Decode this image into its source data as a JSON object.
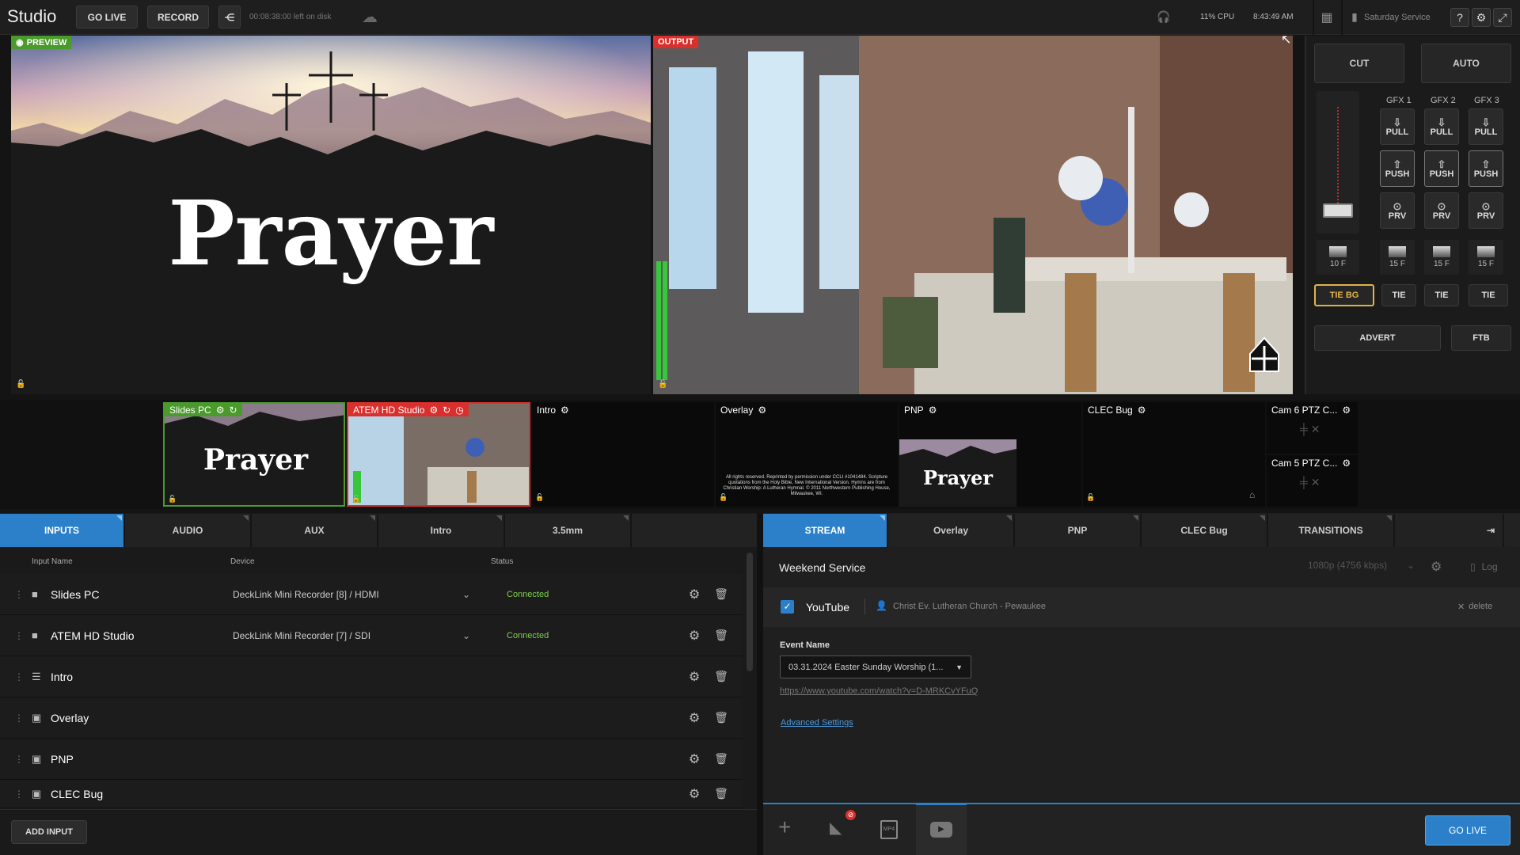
{
  "app": {
    "title": "Studio"
  },
  "topbar": {
    "go_live": "GO LIVE",
    "record": "RECORD",
    "disk_left": "00:08:38:00 left on disk",
    "cpu": "11% CPU",
    "clock": "8:43:49 AM",
    "service": "Saturday Service"
  },
  "preview": {
    "label": "PREVIEW",
    "slide_text": "Prayer"
  },
  "output": {
    "label": "OUTPUT"
  },
  "controls": {
    "cut": "CUT",
    "auto": "AUTO",
    "gfx": [
      {
        "name": "GFX 1",
        "pull": "PULL",
        "push": "PUSH",
        "prv": "PRV",
        "rate": "15 F"
      },
      {
        "name": "GFX 2",
        "pull": "PULL",
        "push": "PUSH",
        "prv": "PRV",
        "rate": "15 F"
      },
      {
        "name": "GFX 3",
        "pull": "PULL",
        "push": "PUSH",
        "prv": "PRV",
        "rate": "15 F"
      }
    ],
    "main_rate": "10 F",
    "tie_bg": "TIE BG",
    "tie": "TIE",
    "advert": "ADVERT",
    "ftb": "FTB"
  },
  "multiview": [
    {
      "label": "Slides PC",
      "state": "preview",
      "text": "Prayer"
    },
    {
      "label": "ATEM HD Studio",
      "state": "program"
    },
    {
      "label": "Intro"
    },
    {
      "label": "Overlay",
      "fine_print": "All rights reserved. Reprinted by permission under CCLI #1041484. Scripture quotations from the Holy Bible, New International Version. Hymns are from Christian Worship: A Lutheran Hymnal. © 2011 Northwestern Publishing House, Milwaukee, WI."
    },
    {
      "label": "PNP",
      "text": "Prayer"
    },
    {
      "label": "CLEC Bug"
    },
    {
      "label": "Cam 6 PTZ C..."
    },
    {
      "label": "Cam 5 PTZ C..."
    }
  ],
  "inputs_panel": {
    "tabs": [
      "INPUTS",
      "AUDIO",
      "AUX",
      "Intro",
      "3.5mm"
    ],
    "columns": [
      "Input Name",
      "Device",
      "Status"
    ],
    "rows": [
      {
        "name": "Slides PC",
        "device": "DeckLink Mini Recorder [8] / HDMI",
        "status": "Connected",
        "icon": "camera-icon"
      },
      {
        "name": "ATEM HD Studio",
        "device": "DeckLink Mini Recorder [7] / SDI",
        "status": "Connected",
        "icon": "camera-icon"
      },
      {
        "name": "Intro",
        "device": "",
        "status": "",
        "icon": "playlist-icon"
      },
      {
        "name": "Overlay",
        "device": "",
        "status": "",
        "icon": "image-icon"
      },
      {
        "name": "PNP",
        "device": "",
        "status": "",
        "icon": "image-icon"
      },
      {
        "name": "CLEC Bug",
        "device": "",
        "status": "",
        "icon": "image-icon"
      }
    ],
    "add_input": "ADD INPUT"
  },
  "stream_panel": {
    "tabs": [
      "STREAM",
      "Overlay",
      "PNP",
      "CLEC Bug",
      "TRANSITIONS"
    ],
    "service_name": "Weekend Service",
    "quality": "1080p (4756 kbps)",
    "log": "Log",
    "destination": "YouTube",
    "account": "Christ Ev. Lutheran Church - Pewaukee",
    "delete": "delete",
    "event_label": "Event Name",
    "event_value": "03.31.2024 Easter Sunday Worship (1...",
    "url": "https://www.youtube.com/watch?v=D-MRKCvYFuQ",
    "advanced": "Advanced Settings",
    "go_live": "GO LIVE"
  },
  "colors": {
    "accent": "#2b80c9",
    "preview": "#4a9a2c",
    "program": "#d9302e",
    "connected": "#7bd34a",
    "tie_bg": "#e0b24a"
  }
}
